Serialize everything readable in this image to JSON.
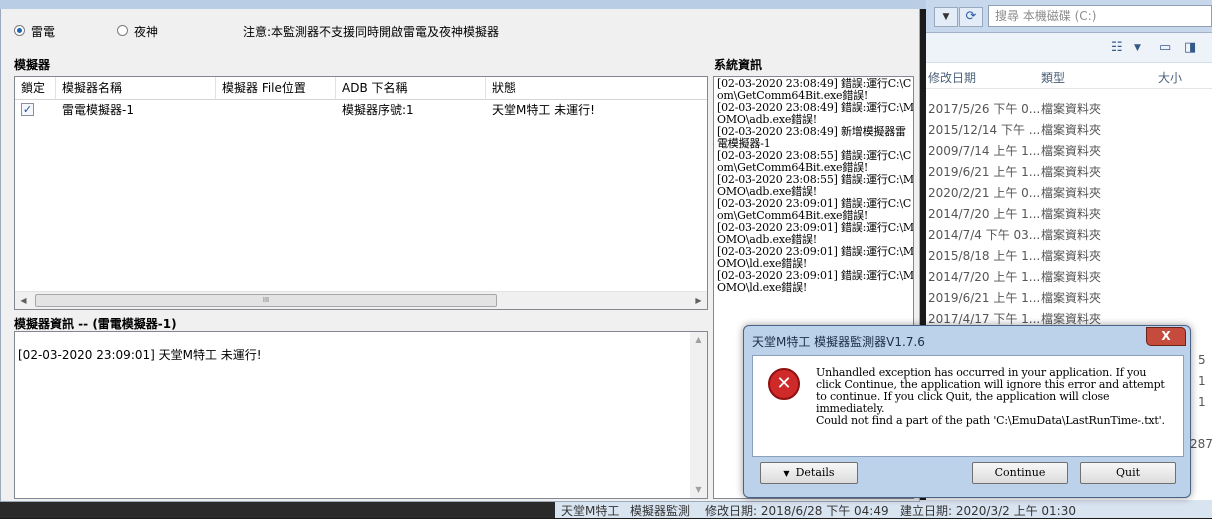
{
  "explorer": {
    "search_placeholder": "搜尋 本機磁碟 (C:)",
    "columns": {
      "modified": "修改日期",
      "type": "類型",
      "size": "大小"
    },
    "rows": [
      {
        "date": "2017/5/26 下午 0...",
        "type": "檔案資料夾"
      },
      {
        "date": "2015/12/14 下午 ...",
        "type": "檔案資料夾"
      },
      {
        "date": "2009/7/14 上午 1...",
        "type": "檔案資料夾"
      },
      {
        "date": "2019/6/21 上午 1...",
        "type": "檔案資料夾"
      },
      {
        "date": "2020/2/21 上午 0...",
        "type": "檔案資料夾"
      },
      {
        "date": "2014/7/20 上午 1...",
        "type": "檔案資料夾"
      },
      {
        "date": "2014/7/4 下午 03...",
        "type": "檔案資料夾"
      },
      {
        "date": "2015/8/18 上午 1...",
        "type": "檔案資料夾"
      },
      {
        "date": "2014/7/20 上午 1...",
        "type": "檔案資料夾"
      },
      {
        "date": "2019/6/21 上午 1...",
        "type": "檔案資料夾"
      },
      {
        "date": "2017/4/17 下午 1...",
        "type": "檔案資料夾"
      }
    ],
    "size_fragments": [
      "5",
      "1",
      "1",
      "287"
    ]
  },
  "taskbar": {
    "app": "天堂M特工",
    "label": "模擬器監測",
    "modified": "修改日期: 2018/6/28 下午 04:49",
    "created": "建立日期: 2020/3/2 上午 01:30"
  },
  "main": {
    "radios": [
      {
        "label": "雷電",
        "selected": true
      },
      {
        "label": "夜神",
        "selected": false
      }
    ],
    "notice": "注意:本監測器不支援同時開啟雷電及夜神模擬器",
    "emulator_section": "模擬器",
    "table": {
      "columns": [
        "鎖定",
        "模擬器名稱",
        "模擬器 File位置",
        "ADB 下名稱",
        "狀態"
      ],
      "rows": [
        {
          "locked": true,
          "name": "雷電模擬器-1",
          "file": "",
          "adb": "模擬器序號:1",
          "status": "天堂M特工 未運行!"
        }
      ]
    },
    "scroll_grip": "III",
    "info_section": "模擬器資訊 -- (雷電模擬器-1)",
    "info_text": "[02-03-2020 23:09:01] 天堂M特工 未運行!",
    "system_section": "系統資訊",
    "system_log": [
      "[02-03-2020 23:08:49] 錯誤:運行C:\\Com\\GetComm64Bit.exe錯誤!",
      "[02-03-2020 23:08:49] 錯誤:運行C:\\MOMO\\adb.exe錯誤!",
      "[02-03-2020 23:08:49] 新增模擬器雷電模擬器-1",
      "[02-03-2020 23:08:55] 錯誤:運行C:\\Com\\GetComm64Bit.exe錯誤!",
      "[02-03-2020 23:08:55] 錯誤:運行C:\\MOMO\\adb.exe錯誤!",
      "[02-03-2020 23:09:01] 錯誤:運行C:\\Com\\GetComm64Bit.exe錯誤!",
      "[02-03-2020 23:09:01] 錯誤:運行C:\\MOMO\\adb.exe錯誤!",
      "[02-03-2020 23:09:01] 錯誤:運行C:\\MOMO\\ld.exe錯誤!",
      "[02-03-2020 23:09:01] 錯誤:運行C:\\MOMO\\ld.exe錯誤!"
    ]
  },
  "dialog": {
    "title": "天堂M特工 模擬器監測器V1.7.6",
    "close": "X",
    "message": "Unhandled exception has occurred in your application. If you click Continue, the application will ignore this error and attempt to continue. If you click Quit, the application will close immediately.",
    "path_error": "Could not find a part of the path 'C:\\EmuData\\LastRunTime-.txt'.",
    "buttons": {
      "details": "Details",
      "continue": "Continue",
      "quit": "Quit"
    }
  },
  "colors": {
    "window_bg": "#f0f0f0",
    "dialog_frame": "#bcd1ea",
    "close_red": "#c54b3c",
    "error_red": "#cf2929"
  }
}
